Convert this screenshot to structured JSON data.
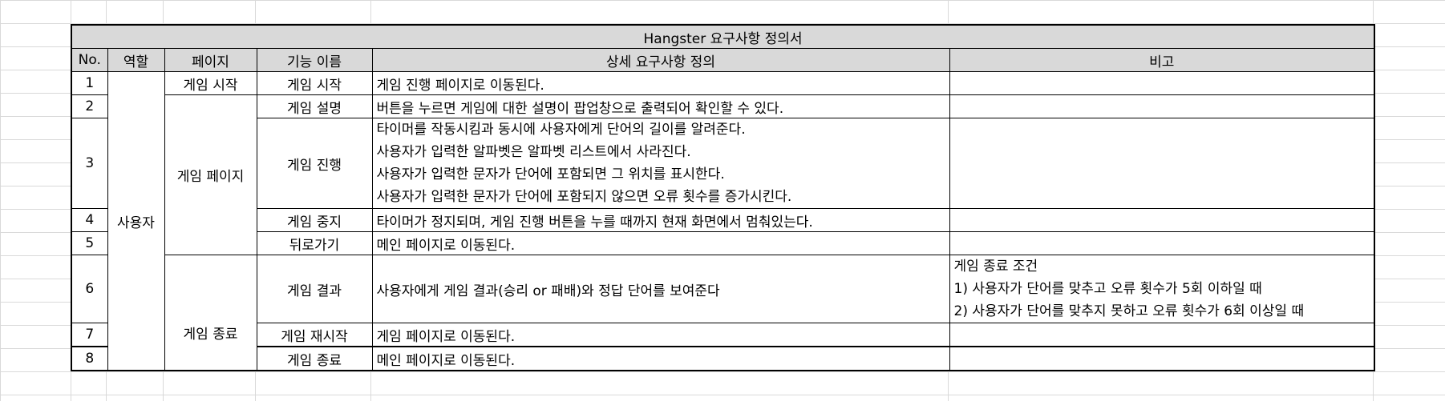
{
  "title": "Hangster 요구사항 정의서",
  "headers": {
    "no": "No.",
    "role": "역할",
    "page": "페이지",
    "feature": "기능 이름",
    "detail": "상세 요구사항 정의",
    "note": "비고"
  },
  "role": "사용자",
  "pages": {
    "start": "게임 시작",
    "game": "게임 페이지",
    "end": "게임 종료"
  },
  "rows": [
    {
      "no": "1",
      "feature": "게임 시작",
      "detail": [
        "게임 진행 페이지로 이동된다."
      ]
    },
    {
      "no": "2",
      "feature": "게임 설명",
      "detail": [
        "버튼을 누르면 게임에 대한 설명이 팝업창으로 출력되어 확인할 수 있다."
      ]
    },
    {
      "no": "3",
      "feature": "게임 진행",
      "detail": [
        "타이머를 작동시킴과 동시에 사용자에게 단어의 길이를 알려준다.",
        "사용자가 입력한 알파벳은 알파벳 리스트에서 사라진다.",
        "사용자가 입력한 문자가 단어에 포함되면 그 위치를 표시한다.",
        "사용자가 입력한 문자가 단어에 포함되지 않으면 오류 횟수를 증가시킨다."
      ]
    },
    {
      "no": "4",
      "feature": "게임 중지",
      "detail": [
        "타이머가 정지되며, 게임 진행 버튼을 누를 때까지 현재 화면에서 멈춰있는다."
      ]
    },
    {
      "no": "5",
      "feature": "뒤로가기",
      "detail": [
        "메인 페이지로 이동된다."
      ]
    },
    {
      "no": "6",
      "feature": "게임 결과",
      "detail": [
        "사용자에게 게임 결과(승리 or 패배)와 정답 단어를 보여준다"
      ],
      "note": [
        "게임 종료 조건",
        "1) 사용자가 단어를 맞추고 오류 횟수가 5회 이하일 때",
        "2) 사용자가 단어를 맞추지 못하고 오류 횟수가 6회 이상일 때"
      ]
    },
    {
      "no": "7",
      "feature": "게임 재시작",
      "detail": [
        "게임 페이지로 이동된다."
      ]
    },
    {
      "no": "8",
      "feature": "게임 종료",
      "detail": [
        "메인 페이지로 이동된다."
      ]
    }
  ]
}
